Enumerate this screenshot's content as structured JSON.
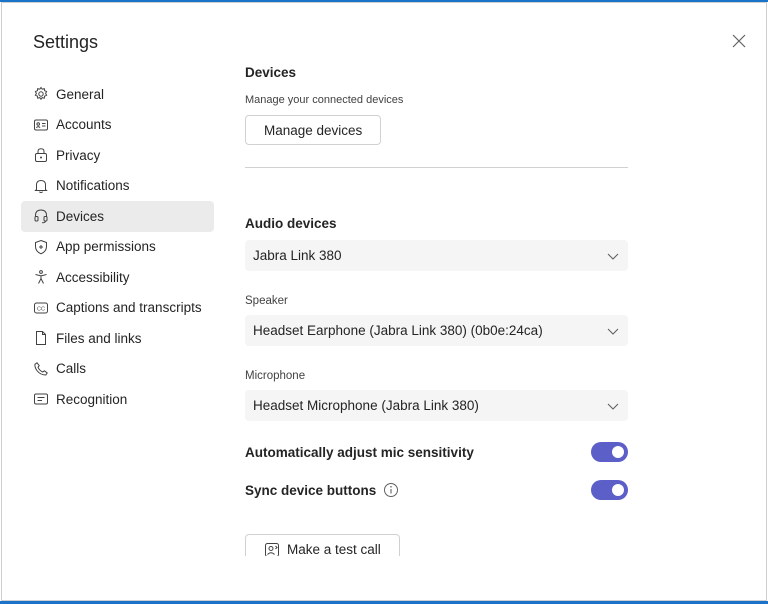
{
  "dialog": {
    "title": "Settings"
  },
  "sidebar": {
    "items": [
      {
        "label": "General",
        "icon": "gear-icon",
        "active": false
      },
      {
        "label": "Accounts",
        "icon": "id-card-icon",
        "active": false
      },
      {
        "label": "Privacy",
        "icon": "lock-icon",
        "active": false
      },
      {
        "label": "Notifications",
        "icon": "bell-icon",
        "active": false
      },
      {
        "label": "Devices",
        "icon": "headset-icon",
        "active": true
      },
      {
        "label": "App permissions",
        "icon": "shield-icon",
        "active": false
      },
      {
        "label": "Accessibility",
        "icon": "accessibility-icon",
        "active": false
      },
      {
        "label": "Captions and transcripts",
        "icon": "closed-captions-icon",
        "active": false
      },
      {
        "label": "Files and links",
        "icon": "document-icon",
        "active": false
      },
      {
        "label": "Calls",
        "icon": "phone-icon",
        "active": false
      },
      {
        "label": "Recognition",
        "icon": "recognition-icon",
        "active": false
      }
    ]
  },
  "devices": {
    "heading": "Devices",
    "description": "Manage your connected devices",
    "manage_button": "Manage devices"
  },
  "audio": {
    "heading": "Audio devices",
    "audio_device_value": "Jabra Link 380",
    "speaker_label": "Speaker",
    "speaker_value": "Headset Earphone (Jabra Link 380) (0b0e:24ca)",
    "microphone_label": "Microphone",
    "microphone_value": "Headset Microphone (Jabra Link 380)",
    "auto_mic_label": "Automatically adjust mic sensitivity",
    "auto_mic_on": true,
    "sync_buttons_label": "Sync device buttons",
    "sync_buttons_on": true,
    "test_call_button": "Make a test call"
  },
  "colors": {
    "accent": "#5b5fc7",
    "window_border": "#1a73c8",
    "active_nav_bg": "#ebebeb"
  }
}
